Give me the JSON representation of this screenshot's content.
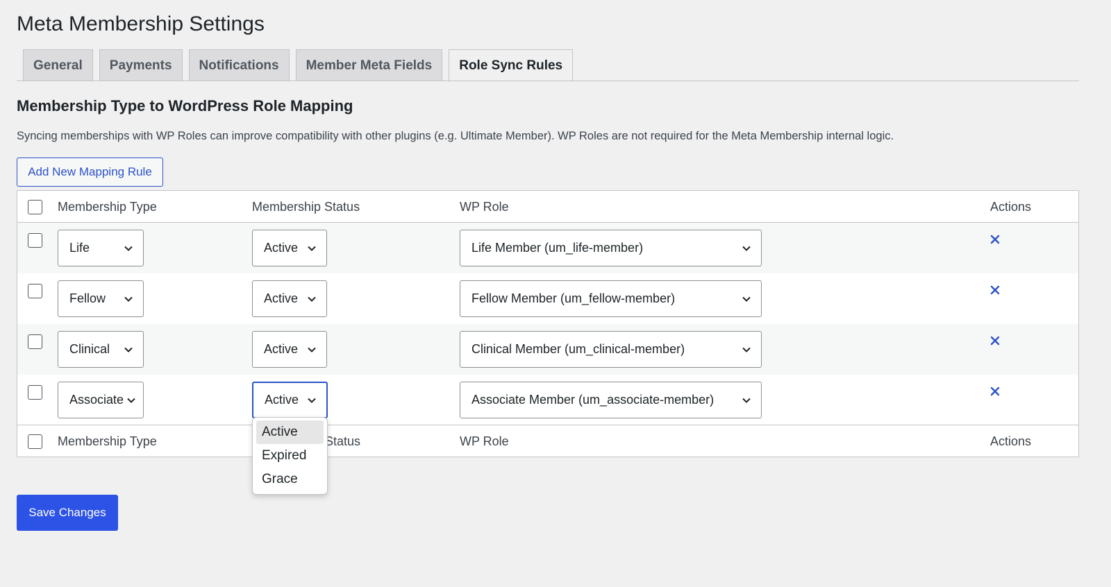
{
  "page": {
    "title": "Meta Membership Settings"
  },
  "tabs": [
    {
      "label": "General",
      "active": false
    },
    {
      "label": "Payments",
      "active": false
    },
    {
      "label": "Notifications",
      "active": false
    },
    {
      "label": "Member Meta Fields",
      "active": false
    },
    {
      "label": "Role Sync Rules",
      "active": true
    }
  ],
  "section": {
    "title": "Membership Type to WordPress Role Mapping",
    "description": "Syncing memberships with WP Roles can improve compatibility with other plugins (e.g. Ultimate Member). WP Roles are not required for the Meta Membership internal logic.",
    "add_button": "Add New Mapping Rule"
  },
  "table": {
    "columns": [
      "Membership Type",
      "Membership Status",
      "WP Role",
      "Actions"
    ],
    "rows": [
      {
        "type": "Life",
        "status": "Active",
        "role": "Life Member (um_life-member)"
      },
      {
        "type": "Fellow",
        "status": "Active",
        "role": "Fellow Member (um_fellow-member)"
      },
      {
        "type": "Clinical",
        "status": "Active",
        "role": "Clinical Member (um_clinical-member)"
      },
      {
        "type": "Associate",
        "status": "Active",
        "role": "Associate Member (um_associate-member)"
      }
    ],
    "footer_columns": [
      "Membership Type",
      "Status",
      "WP Role",
      "Actions"
    ]
  },
  "status_dropdown": {
    "options": [
      "Active",
      "Expired",
      "Grace"
    ],
    "selected": "Active"
  },
  "save_button": "Save Changes",
  "colors": {
    "accent": "#2c52e6",
    "link": "#2c52c9",
    "background": "#f0f0f1"
  }
}
